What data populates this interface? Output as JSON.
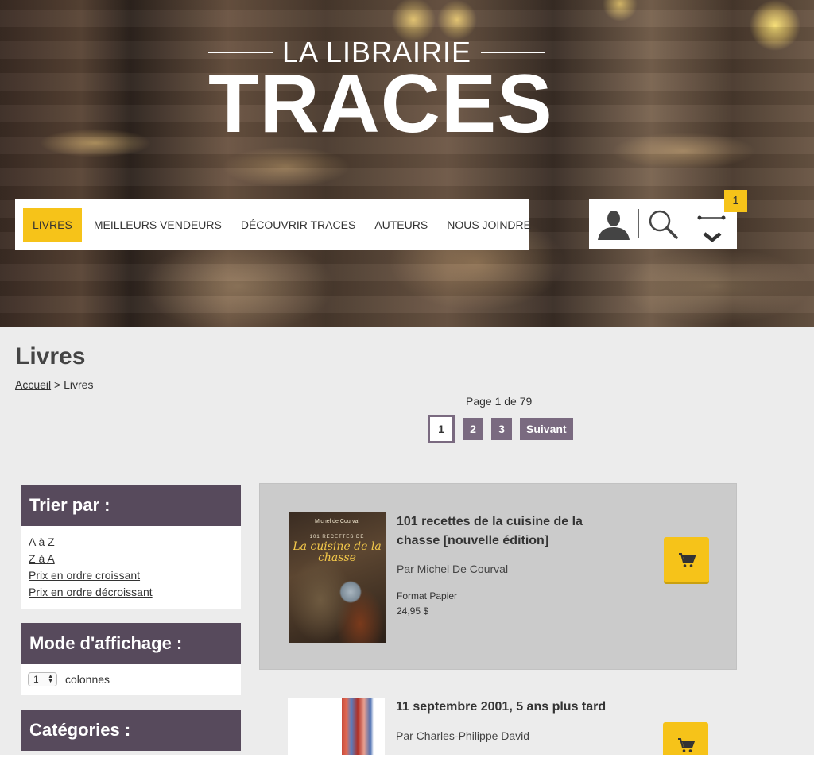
{
  "brand": {
    "small": "LA LIBRAIRIE",
    "big": "TRACES"
  },
  "nav": [
    {
      "label": "LIVRES",
      "active": true
    },
    {
      "label": "MEILLEURS VENDEURS"
    },
    {
      "label": "DÉCOUVRIR TRACES"
    },
    {
      "label": "AUTEURS"
    },
    {
      "label": "NOUS JOINDRE"
    }
  ],
  "tools": {
    "user_icon": "user-icon",
    "search_icon": "search-icon",
    "cart_icon": "cart-icon",
    "cart_count": "1"
  },
  "page": {
    "title": "Livres",
    "breadcrumb": {
      "home": "Accueil",
      "separator": " > ",
      "current": "Livres"
    }
  },
  "pagination": {
    "info": "Page 1 de 79",
    "pages": [
      "1",
      "2",
      "3"
    ],
    "current": "1",
    "next": "Suivant"
  },
  "sidebar": {
    "sort": {
      "title": "Trier par :",
      "options": [
        "A à Z",
        "Z à A",
        "Prix en ordre croissant",
        "Prix en ordre décroissant"
      ]
    },
    "display": {
      "title": "Mode d'affichage :",
      "value": "1",
      "suffix": "colonnes"
    },
    "categories": {
      "title": "Catégories :"
    }
  },
  "books": [
    {
      "title": "101 recettes de la cuisine de la chasse [nouvelle édition]",
      "author": "Par Michel De Courval",
      "format": "Format Papier",
      "price": "24,95 $",
      "cover": {
        "author": "Michel de Courval",
        "number": "101 RECETTES DE",
        "title": "La cuisine de la chasse"
      }
    },
    {
      "title": "11 septembre 2001, 5 ans plus tard",
      "author": "Par Charles-Philippe David"
    }
  ],
  "colors": {
    "accent": "#f6c319",
    "panel": "#574a5c",
    "pager": "#7a6a80"
  }
}
